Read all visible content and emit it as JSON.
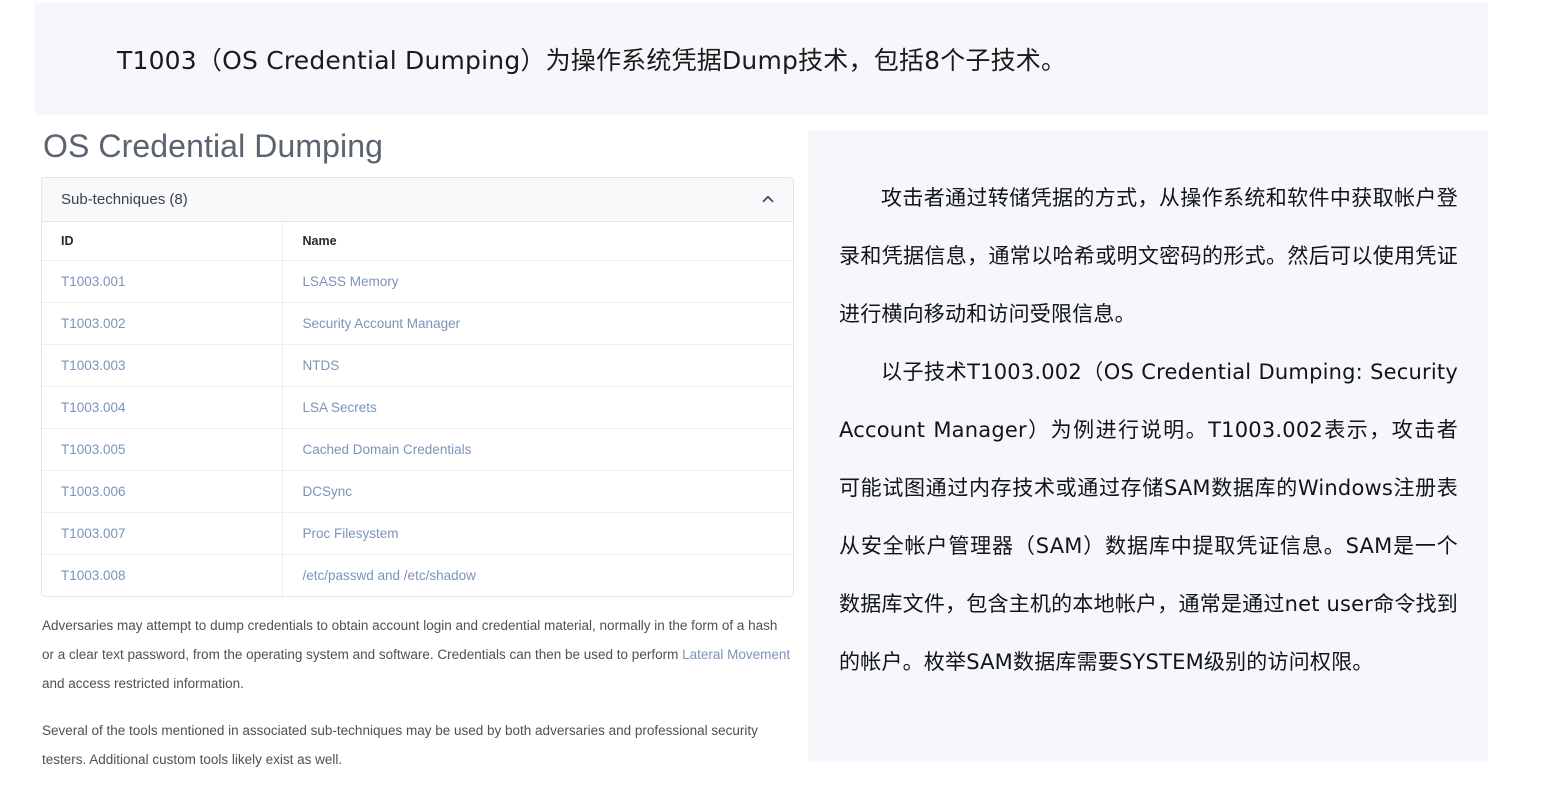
{
  "banner": {
    "text": "T1003（OS Credential Dumping）为操作系统凭据Dump技术，包括8个子技术。",
    "background": "#f6f7fb"
  },
  "page_title": "OS Credential Dumping",
  "subtechniques_panel": {
    "header_label": "Sub-techniques (8)",
    "collapse_icon": "chevron-up-icon",
    "columns": [
      "ID",
      "Name"
    ],
    "rows": [
      {
        "id": "T1003.001",
        "name": "LSASS Memory"
      },
      {
        "id": "T1003.002",
        "name": "Security Account Manager"
      },
      {
        "id": "T1003.003",
        "name": "NTDS"
      },
      {
        "id": "T1003.004",
        "name": "LSA Secrets"
      },
      {
        "id": "T1003.005",
        "name": "Cached Domain Credentials"
      },
      {
        "id": "T1003.006",
        "name": "DCSync"
      },
      {
        "id": "T1003.007",
        "name": "Proc Filesystem"
      },
      {
        "id": "T1003.008",
        "name": "/etc/passwd and /etc/shadow"
      }
    ]
  },
  "description": {
    "paragraph1_part1": "Adversaries may attempt to dump credentials to obtain account login and credential material, normally in the form of a hash or a clear text password, from the operating system and software. Credentials can then be used to perform ",
    "paragraph1_link": "Lateral Movement",
    "paragraph1_part2": " and access restricted information.",
    "paragraph2": "Several of the tools mentioned in associated sub-techniques may be used by both adversaries and professional security testers. Additional custom tools likely exist as well."
  },
  "right_panel": {
    "background": "#f6f7fb",
    "paragraph1": "攻击者通过转储凭据的方式，从操作系统和软件中获取帐户登录和凭据信息，通常以哈希或明文密码的形式。然后可以使用凭证进行横向移动和访问受限信息。",
    "paragraph2": "以子技术T1003.002（OS Credential Dumping: Security Account Manager）为例进行说明。T1003.002表示，攻击者可能试图通过内存技术或通过存储SAM数据库的Windows注册表从安全帐户管理器（SAM）数据库中提取凭证信息。SAM是一个数据库文件，包含主机的本地帐户，通常是通过net user命令找到的帐户。枚举SAM数据库需要SYSTEM级别的访问权限。"
  },
  "colors": {
    "link": "#7c93b8",
    "title": "#5a6370",
    "body_text": "#4b5059",
    "panel_bg": "#f6f7fb"
  }
}
